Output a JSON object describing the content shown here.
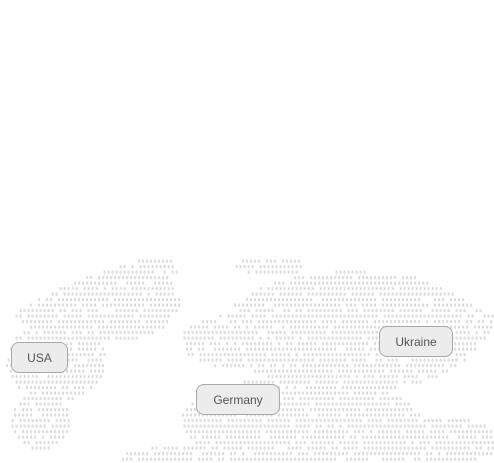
{
  "map": {
    "dot_color": "#dcdcdc",
    "markers": [
      {
        "id": "usa",
        "label": "USA"
      },
      {
        "id": "germany",
        "label": "Germany"
      },
      {
        "id": "ukraine",
        "label": "Ukraine"
      }
    ]
  },
  "colors": {
    "background": "#ffffff",
    "pill_fill": "#ececec",
    "pill_border": "#a9a9a9",
    "pill_text": "#555555"
  }
}
